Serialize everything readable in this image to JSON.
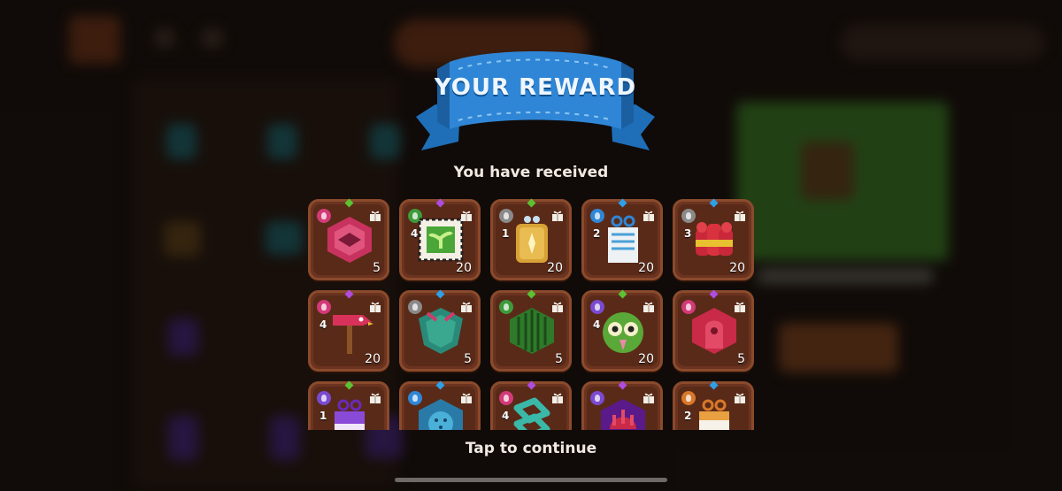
{
  "title": "YOUR REWARD",
  "subtitle": "You have received",
  "continue_label": "Tap to continue",
  "colors": {
    "banner_blue": "#2f86d6",
    "card_brown": "#6a3420",
    "panel_green": "#3f8a2a"
  },
  "rewards": [
    {
      "name": "pink-hex-badge",
      "level": "",
      "count": "5",
      "rarity": "green",
      "category": "pink"
    },
    {
      "name": "sprout-stamp",
      "level": "4",
      "count": "20",
      "rarity": "purple",
      "category": "green"
    },
    {
      "name": "gold-tag",
      "level": "1",
      "count": "20",
      "rarity": "green",
      "category": "gray"
    },
    {
      "name": "pattern-ticket",
      "level": "2",
      "count": "20",
      "rarity": "blue",
      "category": "blue"
    },
    {
      "name": "red-firecrackers",
      "level": "3",
      "count": "20",
      "rarity": "blue",
      "category": "gray"
    },
    {
      "name": "bird-hammer",
      "level": "4",
      "count": "20",
      "rarity": "purple",
      "category": "pink"
    },
    {
      "name": "teal-shield-badge",
      "level": "",
      "count": "5",
      "rarity": "blue",
      "category": "gray"
    },
    {
      "name": "watermelon-hex",
      "level": "",
      "count": "5",
      "rarity": "green",
      "category": "green"
    },
    {
      "name": "owl-mask",
      "level": "4",
      "count": "20",
      "rarity": "green",
      "category": "purple"
    },
    {
      "name": "red-door-hex",
      "level": "",
      "count": "5",
      "rarity": "purple",
      "category": "pink"
    },
    {
      "name": "purple-bow-ticket",
      "level": "1",
      "count": "",
      "rarity": "green",
      "category": "purple"
    },
    {
      "name": "blue-spiked-hex",
      "level": "",
      "count": "",
      "rarity": "blue",
      "category": "blue"
    },
    {
      "name": "teal-knot",
      "level": "4",
      "count": "",
      "rarity": "purple",
      "category": "pink"
    },
    {
      "name": "purple-crest-hex",
      "level": "",
      "count": "",
      "rarity": "purple",
      "category": "purple"
    },
    {
      "name": "orange-bow-ticket",
      "level": "2",
      "count": "",
      "rarity": "blue",
      "category": "orange"
    }
  ]
}
